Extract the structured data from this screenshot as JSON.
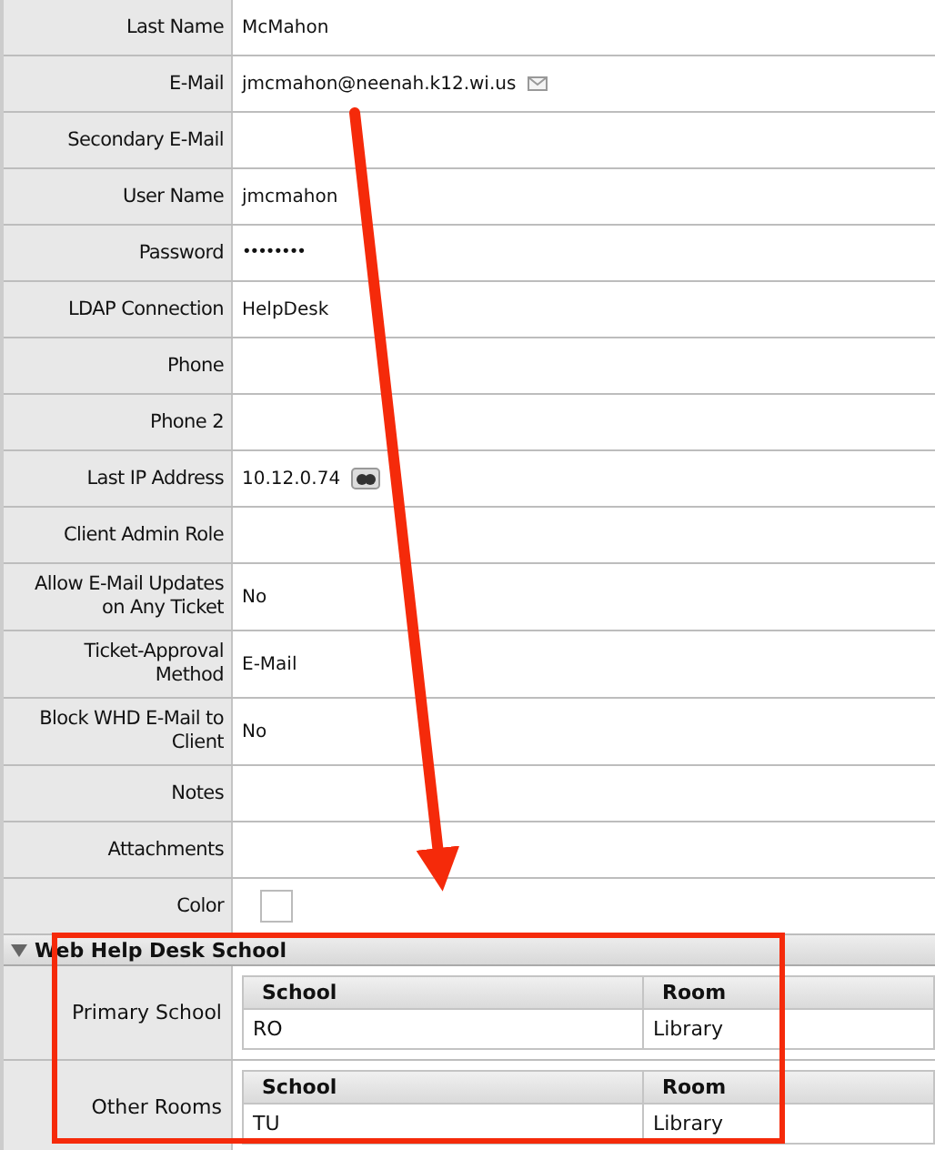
{
  "fields": [
    {
      "label": "Last Name",
      "kind": "text",
      "value": "McMahon"
    },
    {
      "label": "E-Mail",
      "kind": "email",
      "value": "jmcmahon@neenah.k12.wi.us"
    },
    {
      "label": "Secondary E-Mail",
      "kind": "text"
    },
    {
      "label": "User Name",
      "kind": "text",
      "value": "jmcmahon"
    },
    {
      "label": "Password",
      "kind": "password",
      "value": "••••••••"
    },
    {
      "label": "LDAP Connection",
      "kind": "text",
      "value": "HelpDesk"
    },
    {
      "label": "Phone",
      "kind": "text"
    },
    {
      "label": "Phone 2",
      "kind": "text"
    },
    {
      "label": "Last IP Address",
      "kind": "ip",
      "value": "10.12.0.74"
    },
    {
      "label": "Client Admin Role",
      "kind": "text"
    },
    {
      "label": "Allow E-Mail Updates on Any Ticket",
      "kind": "text",
      "value": "No"
    },
    {
      "label": "Ticket-Approval Method",
      "kind": "text",
      "value": "E-Mail"
    },
    {
      "label": "Block WHD E-Mail to Client",
      "kind": "text",
      "value": "No"
    },
    {
      "label": "Notes",
      "kind": "text"
    },
    {
      "label": "Attachments",
      "kind": "text"
    },
    {
      "label": "Color",
      "kind": "color"
    }
  ],
  "section": {
    "title": "Web Help Desk School",
    "expanded": true,
    "groups": [
      {
        "label": "Primary School",
        "columns": [
          "School",
          "Room"
        ],
        "rows": [
          [
            "RO",
            "Library"
          ]
        ]
      },
      {
        "label": "Other Rooms",
        "columns": [
          "School",
          "Room"
        ],
        "rows": [
          [
            "TU",
            "Library"
          ]
        ]
      }
    ]
  }
}
